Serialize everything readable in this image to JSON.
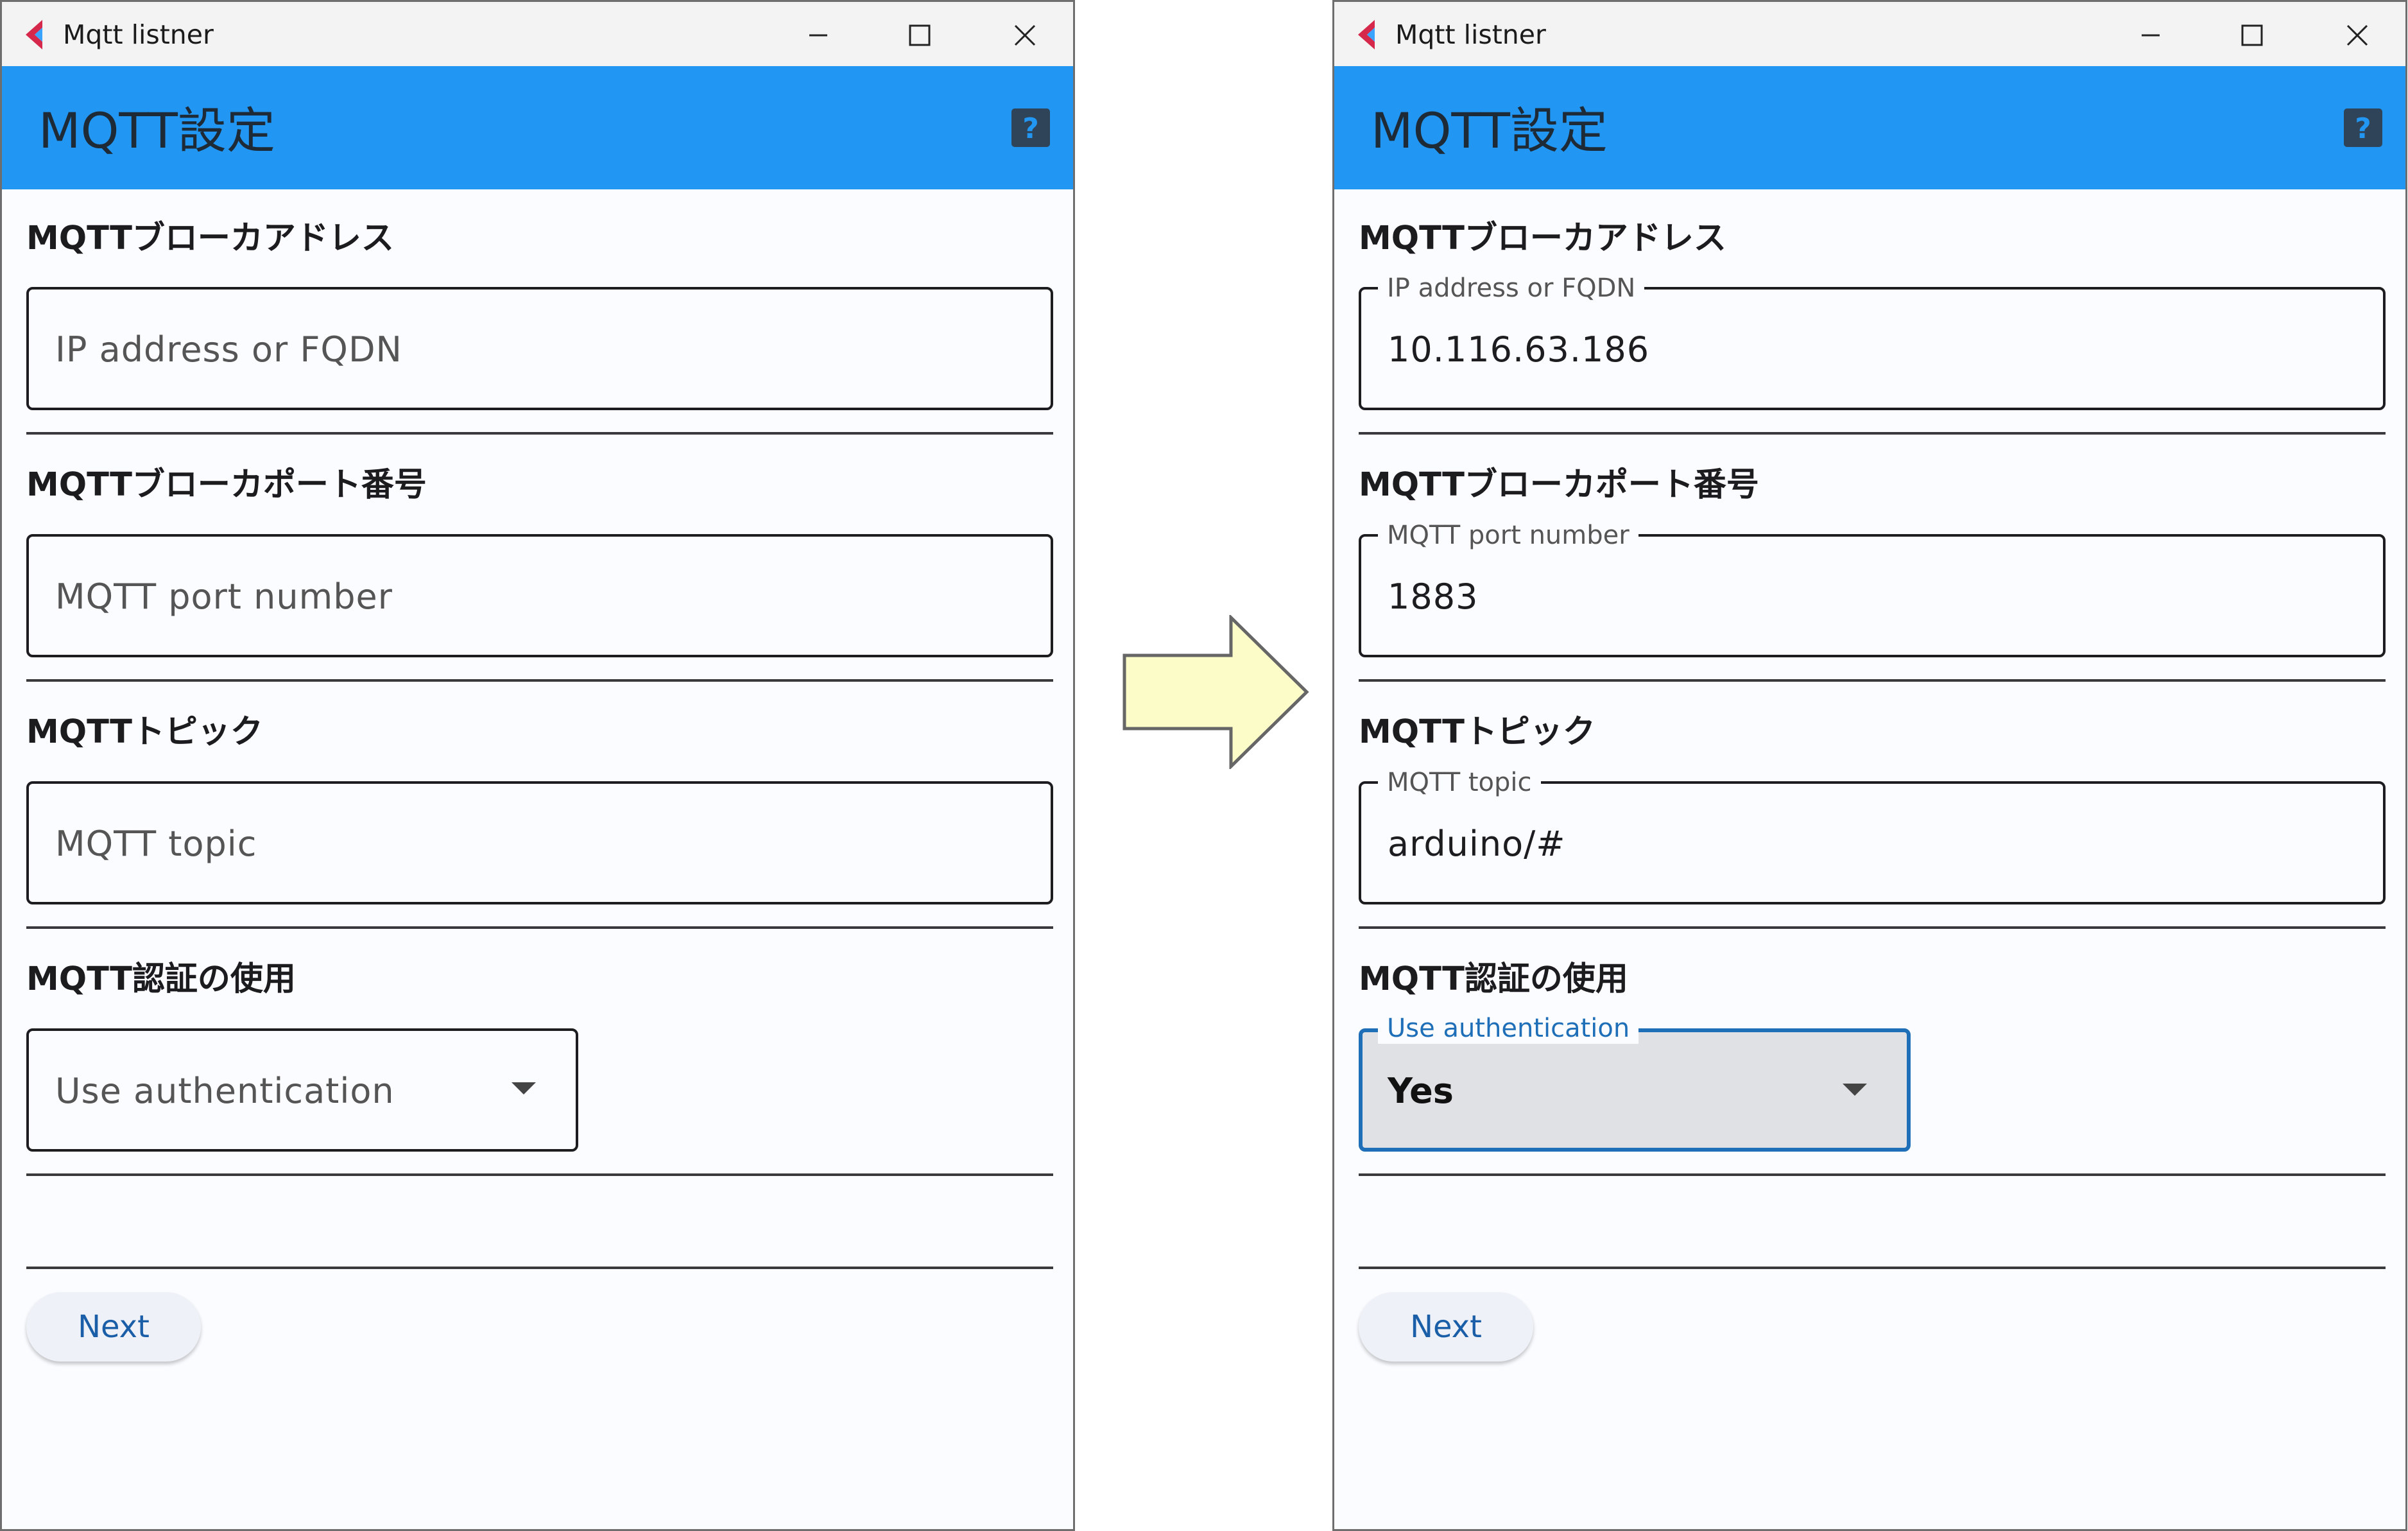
{
  "colors": {
    "appbar": "#2196f3",
    "focus_accent": "#1f6fb8",
    "arrow_fill": "#fcfcc8",
    "arrow_stroke": "#666666"
  },
  "before": {
    "window": {
      "title": "Mqtt listner"
    },
    "appbar": {
      "title": "MQTT設定",
      "help_icon": "help-icon"
    },
    "broker_address": {
      "label": "MQTTブローカアドレス",
      "placeholder": "IP address or FQDN"
    },
    "broker_port": {
      "label": "MQTTブローカポート番号",
      "placeholder": "MQTT port number"
    },
    "topic": {
      "label": "MQTTトピック",
      "placeholder": "MQTT topic"
    },
    "auth": {
      "label": "MQTT認証の使用",
      "placeholder": "Use authentication"
    },
    "next_label": "Next"
  },
  "after": {
    "window": {
      "title": "Mqtt listner"
    },
    "appbar": {
      "title": "MQTT設定",
      "help_icon": "help-icon"
    },
    "broker_address": {
      "label": "MQTTブローカアドレス",
      "floating_label": "IP address or FQDN",
      "value": "10.116.63.186"
    },
    "broker_port": {
      "label": "MQTTブローカポート番号",
      "floating_label": "MQTT port number",
      "value": "1883"
    },
    "topic": {
      "label": "MQTTトピック",
      "floating_label": "MQTT topic",
      "value": "arduino/#"
    },
    "auth": {
      "label": "MQTT認証の使用",
      "floating_label": "Use authentication",
      "value": "Yes"
    },
    "next_label": "Next"
  }
}
